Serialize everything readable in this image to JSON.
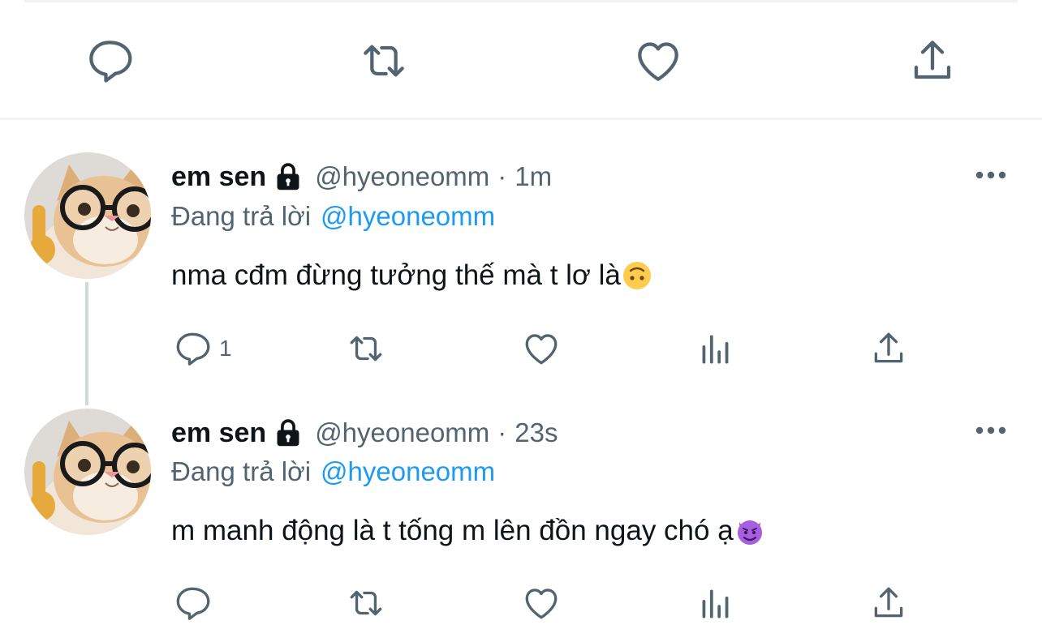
{
  "top_actions": [
    "reply-icon",
    "retweet-icon",
    "like-icon",
    "share-icon"
  ],
  "tweets": [
    {
      "name": "em sen",
      "handle": "@hyeoneomm",
      "separator": "·",
      "time": "1m",
      "reply_label": "Đang trả lời",
      "reply_to": "@hyeoneomm",
      "text": "nma cđm đừng tưởng thế mà t lơ là",
      "emoji": "upside-down-face-emoji",
      "reply_count": "1"
    },
    {
      "name": "em sen",
      "handle": "@hyeoneomm",
      "separator": "·",
      "time": "23s",
      "reply_label": "Đang trả lời",
      "reply_to": "@hyeoneomm",
      "text": "m manh động là t tống m lên đồn ngay chó ạ",
      "emoji": "smiling-devil-emoji",
      "reply_count": ""
    }
  ],
  "colors": {
    "text": "#0f1419",
    "secondary": "#536471",
    "accent": "#1d9bf0",
    "icon": "#536471",
    "divider": "#eff3f4",
    "thread_line": "#cfd9de"
  }
}
